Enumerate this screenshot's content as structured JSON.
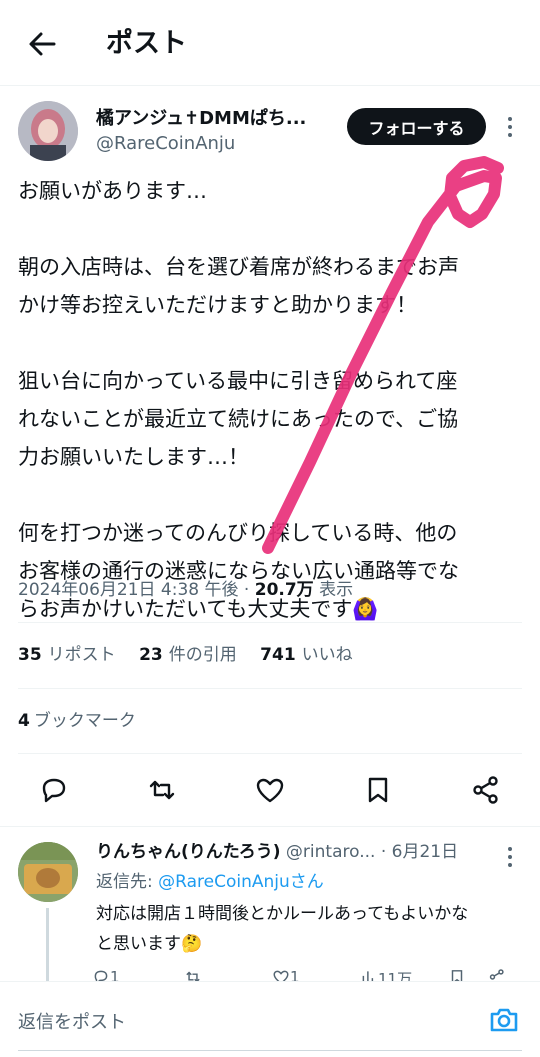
{
  "header": {
    "title": "ポスト"
  },
  "post": {
    "display_name": "橘アンジュ✝DMMぱち...",
    "handle": "@RareCoinAnju",
    "follow_label": "フォローする",
    "lines": [
      "お願いがあります…",
      "",
      "朝の入店時は、台を選び着席が終わるまでお声",
      "かけ等お控えいただけますと助かります！",
      "",
      "狙い台に向かっている最中に引き留められて座",
      "れないことが最近立て続けにあったので、ご協",
      "力お願いいたします…！",
      "",
      "何を打つか迷ってのんびり探している時、他の",
      "お客様の通行の迷惑にならない広い通路等でな",
      "らお声かけいただいても大丈夫です🙆‍♀️"
    ],
    "timestamp": "2024年06月21日 4:38 午後 · ",
    "views_count": "20.7万",
    "views_label": " 表示",
    "reposts_count": "35",
    "reposts_label": "リポスト",
    "quotes_count": "23",
    "quotes_label": "件の引用",
    "likes_count": "741",
    "likes_label": "いいね",
    "bookmarks_count": "4",
    "bookmarks_label": "ブックマーク"
  },
  "reply": {
    "display_name": "りんちゃん(りんたろう)",
    "handle_and_date": " @rintaro... · 6月21日",
    "reply_to_label": "返信先: ",
    "reply_to_link": "@RareCoinAnjuさん",
    "text_lines": [
      "対応は開店１時間後とかルールあってもよいかな",
      "と思います🤔"
    ],
    "reply_count": "1",
    "like_count": "1",
    "views_count": "11万"
  },
  "composer": {
    "placeholder": "返信をポスト"
  },
  "colors": {
    "link": "#1d9bf0",
    "annotation": "#e8307a",
    "follow_bg": "#0f1419"
  },
  "icons": [
    "back-arrow-icon",
    "more-icon",
    "reply-icon",
    "repost-icon",
    "like-icon",
    "bookmark-icon",
    "share-icon",
    "camera-icon"
  ]
}
